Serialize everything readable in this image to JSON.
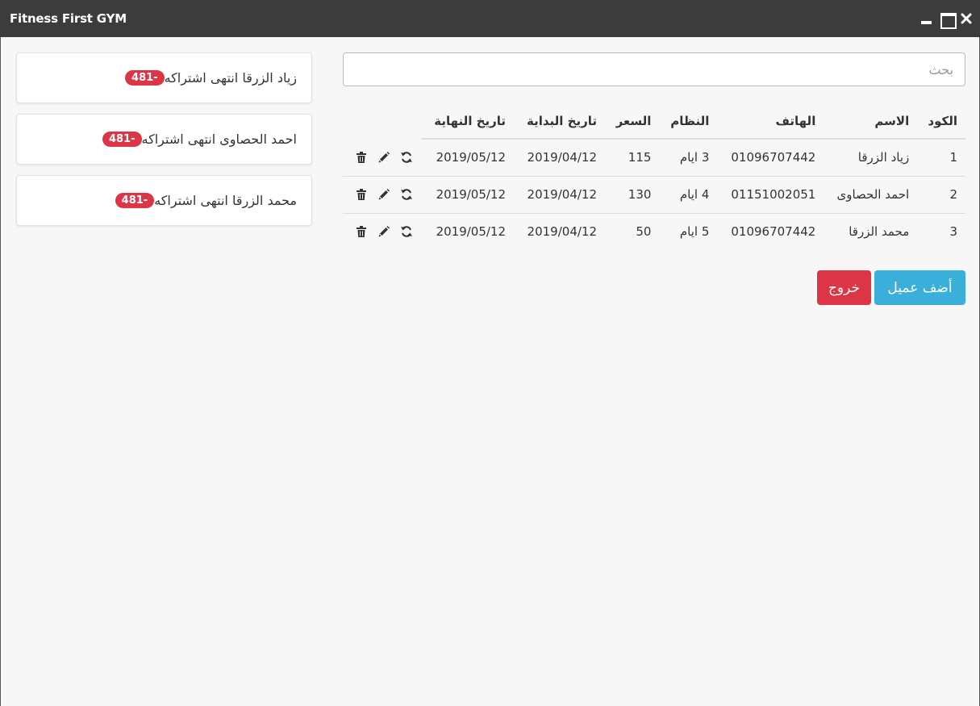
{
  "window": {
    "title": "Fitness First GYM"
  },
  "notifications": [
    {
      "badge": "481-",
      "message": "زياد الزرقا انتهى اشتراكه"
    },
    {
      "badge": "481-",
      "message": "احمد الحصاوى انتهى اشتراكه"
    },
    {
      "badge": "481-",
      "message": "محمد الزرقا انتهى اشتراكه"
    }
  ],
  "search": {
    "placeholder": "بحث",
    "value": ""
  },
  "table": {
    "headers": {
      "code": "الكود",
      "name": "الاسم",
      "phone": "الهاتف",
      "plan": "النظام",
      "price": "السعر",
      "start": "تاريخ البداية",
      "end": "تاريخ النهاية"
    },
    "rows": [
      {
        "code": "1",
        "name": "زياد الزرقا",
        "phone": "01096707442",
        "plan": "3 ايام",
        "price": "115",
        "start": "2019/04/12",
        "end": "2019/05/12"
      },
      {
        "code": "2",
        "name": "احمد الحصاوى",
        "phone": "01151002051",
        "plan": "4 ايام",
        "price": "130",
        "start": "2019/04/12",
        "end": "2019/05/12"
      },
      {
        "code": "3",
        "name": "محمد الزرقا",
        "phone": "01096707442",
        "plan": "5 ايام",
        "price": "50",
        "start": "2019/04/12",
        "end": "2019/05/12"
      }
    ]
  },
  "buttons": {
    "add": "أضف عميل",
    "exit": "خروج"
  },
  "icons": {
    "renew": "refresh-icon",
    "edit": "pencil-icon",
    "delete": "trash-icon"
  },
  "colors": {
    "titlebar": "#3c3c3c",
    "badge": "#dc3545",
    "add_button": "#3aafda",
    "exit_button": "#dc3545"
  }
}
